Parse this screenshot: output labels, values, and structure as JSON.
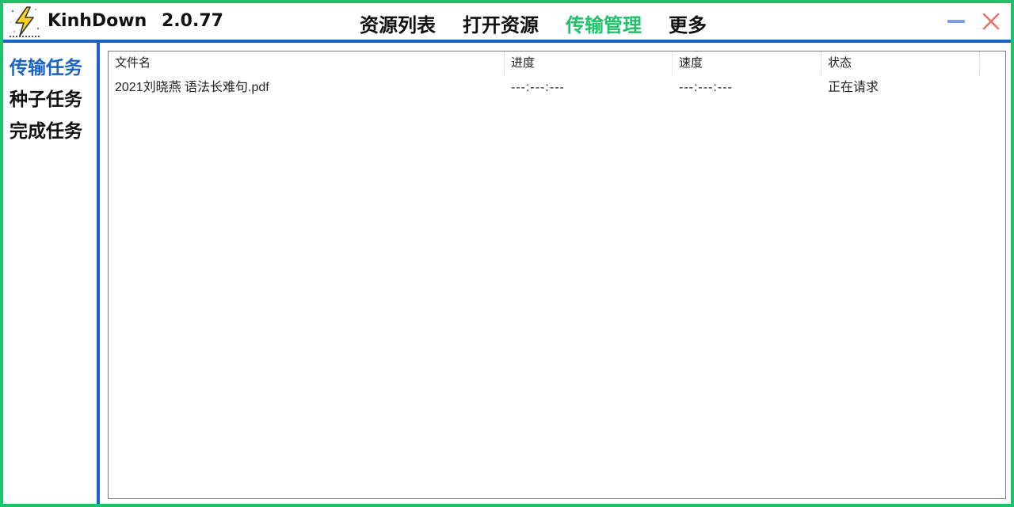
{
  "app": {
    "name": "KinhDown",
    "version": "2.0.77"
  },
  "nav": [
    {
      "label": "资源列表",
      "active": false
    },
    {
      "label": "打开资源",
      "active": false
    },
    {
      "label": "传输管理",
      "active": true
    },
    {
      "label": "更多",
      "active": false
    }
  ],
  "sidebar": {
    "items": [
      {
        "label": "传输任务",
        "active": true
      },
      {
        "label": "种子任务",
        "active": false
      },
      {
        "label": "完成任务",
        "active": false
      }
    ]
  },
  "table": {
    "columns": [
      "文件名",
      "进度",
      "速度",
      "状态"
    ],
    "rows": [
      {
        "name": "2021刘晓燕 语法长难句.pdf",
        "progress": "---:---:---",
        "speed": "---:---:---",
        "status": "正在请求"
      }
    ]
  },
  "colors": {
    "accent_green": "#1fc16b",
    "accent_blue": "#1a63c4",
    "close_red": "#f07070",
    "minimize_blue": "#7f9bf0"
  },
  "icons": {
    "logo": "lightning-bolt-icon",
    "minimize": "minimize-icon",
    "close": "close-icon"
  }
}
